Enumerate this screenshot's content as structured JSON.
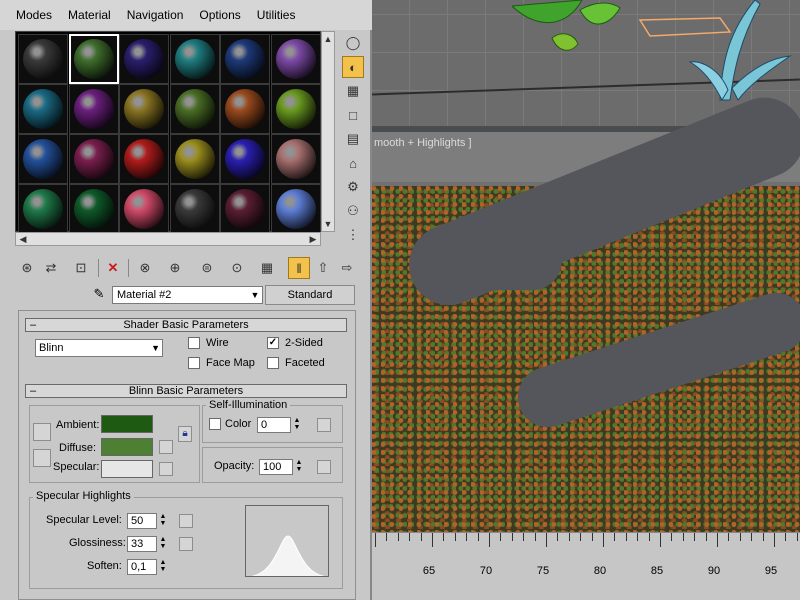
{
  "menu": [
    "Modes",
    "Material",
    "Navigation",
    "Options",
    "Utilities"
  ],
  "spheres": [
    [
      "#3a3a3a",
      "#3f6e2c",
      "#2a1f6d",
      "#1f7d80",
      "#1e3a7a",
      "#7e4aa8"
    ],
    [
      "#1a6a84",
      "#6b1f7d",
      "#8a7522",
      "#4a6e25",
      "#9a4a1e",
      "#6a9a20"
    ],
    [
      "#23509a",
      "#7a1f4e",
      "#b01c1c",
      "#9a8e1e",
      "#2a1fb0",
      "#a87070"
    ],
    [
      "#1f7a4a",
      "#0f5a2a",
      "#d24a6a",
      "#3a3a3a",
      "#5a1f32",
      "#5d7ed6"
    ]
  ],
  "selected_slot": [
    0,
    1
  ],
  "material_name": "Material #2",
  "material_type": "Standard",
  "shader_rollout": {
    "title": "Shader Basic Parameters",
    "shader": "Blinn",
    "wire": {
      "label": "Wire",
      "checked": false
    },
    "two_sided": {
      "label": "2-Sided",
      "checked": true
    },
    "face_map": {
      "label": "Face Map",
      "checked": false
    },
    "faceted": {
      "label": "Faceted",
      "checked": false
    }
  },
  "blinn_rollout": {
    "title": "Blinn Basic Parameters",
    "ambient_label": "Ambient:",
    "ambient_color": "#1e5a12",
    "diffuse_label": "Diffuse:",
    "diffuse_color": "#4e8034",
    "specular_label": "Specular:",
    "specular_color": "#e6e6e6",
    "self_illum_title": "Self-Illumination",
    "color_label": "Color",
    "color_value": "0",
    "opacity_label": "Opacity:",
    "opacity_value": "100",
    "spec_highlights_title": "Specular Highlights",
    "spec_level_label": "Specular Level:",
    "spec_level_value": "50",
    "glossiness_label": "Glossiness:",
    "glossiness_value": "33",
    "soften_label": "Soften:",
    "soften_value": "0,1"
  },
  "viewport": {
    "label": "mooth + Highlights ]",
    "ruler": [
      "65",
      "70",
      "75",
      "80",
      "85",
      "90",
      "95"
    ]
  }
}
